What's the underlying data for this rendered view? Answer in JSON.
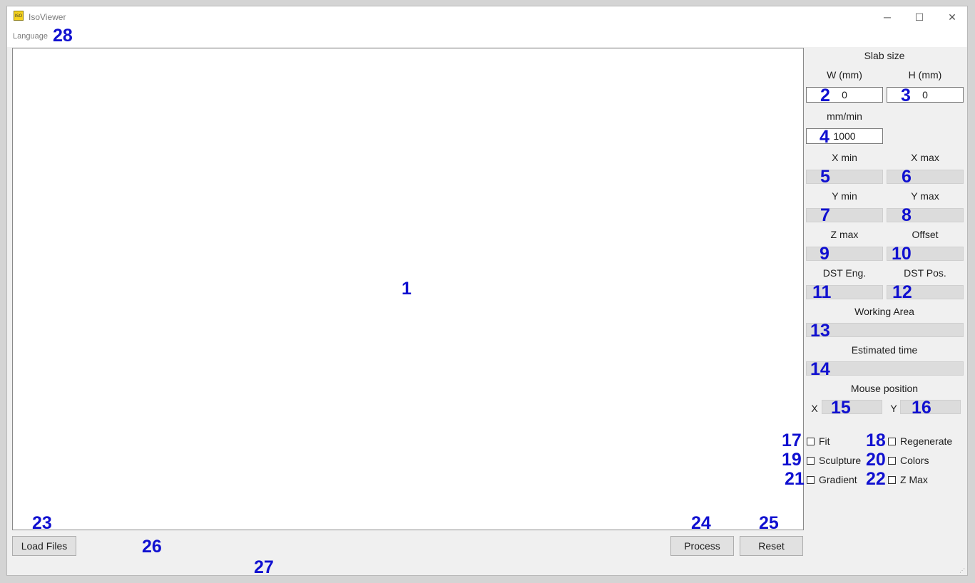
{
  "window": {
    "title": "IsoViewer",
    "icon": "iso-magnifier-icon",
    "icon_text": "ISO",
    "controls": {
      "minimize": "─",
      "maximize": "☐",
      "close": "✕"
    }
  },
  "menu": {
    "language": "Language"
  },
  "panel": {
    "slab_size": "Slab size",
    "w_label": "W (mm)",
    "h_label": "H (mm)",
    "w_value": "0",
    "h_value": "0",
    "speed_label": "mm/min",
    "speed_value": "1000",
    "xmin": "X min",
    "xmax": "X max",
    "ymin": "Y min",
    "ymax": "Y max",
    "zmax": "Z max",
    "offset": "Offset",
    "dst_eng": "DST Eng.",
    "dst_pos": "DST Pos.",
    "working_area": "Working Area",
    "estimated_time": "Estimated time",
    "mouse_position": "Mouse position",
    "mouse_x": "X",
    "mouse_y": "Y"
  },
  "checkboxes": {
    "fit": "Fit",
    "regenerate": "Regenerate",
    "sculpture": "Sculpture",
    "colors": "Colors",
    "gradient": "Gradient",
    "zmax": "Z Max"
  },
  "buttons": {
    "load_files": "Load Files",
    "process": "Process",
    "reset": "Reset"
  },
  "markers": {
    "m1": "1",
    "m2": "2",
    "m3": "3",
    "m4": "4",
    "m5": "5",
    "m6": "6",
    "m7": "7",
    "m8": "8",
    "m9": "9",
    "m10": "10",
    "m11": "11",
    "m12": "12",
    "m13": "13",
    "m14": "14",
    "m15": "15",
    "m16": "16",
    "m17": "17",
    "m18": "18",
    "m19": "19",
    "m20": "20",
    "m21": "21",
    "m22": "22",
    "m23": "23",
    "m24": "24",
    "m25": "25",
    "m26": "26",
    "m27": "27",
    "m28": "28"
  },
  "colors": {
    "marker": "#1010d0",
    "background": "#f0f0f0"
  }
}
